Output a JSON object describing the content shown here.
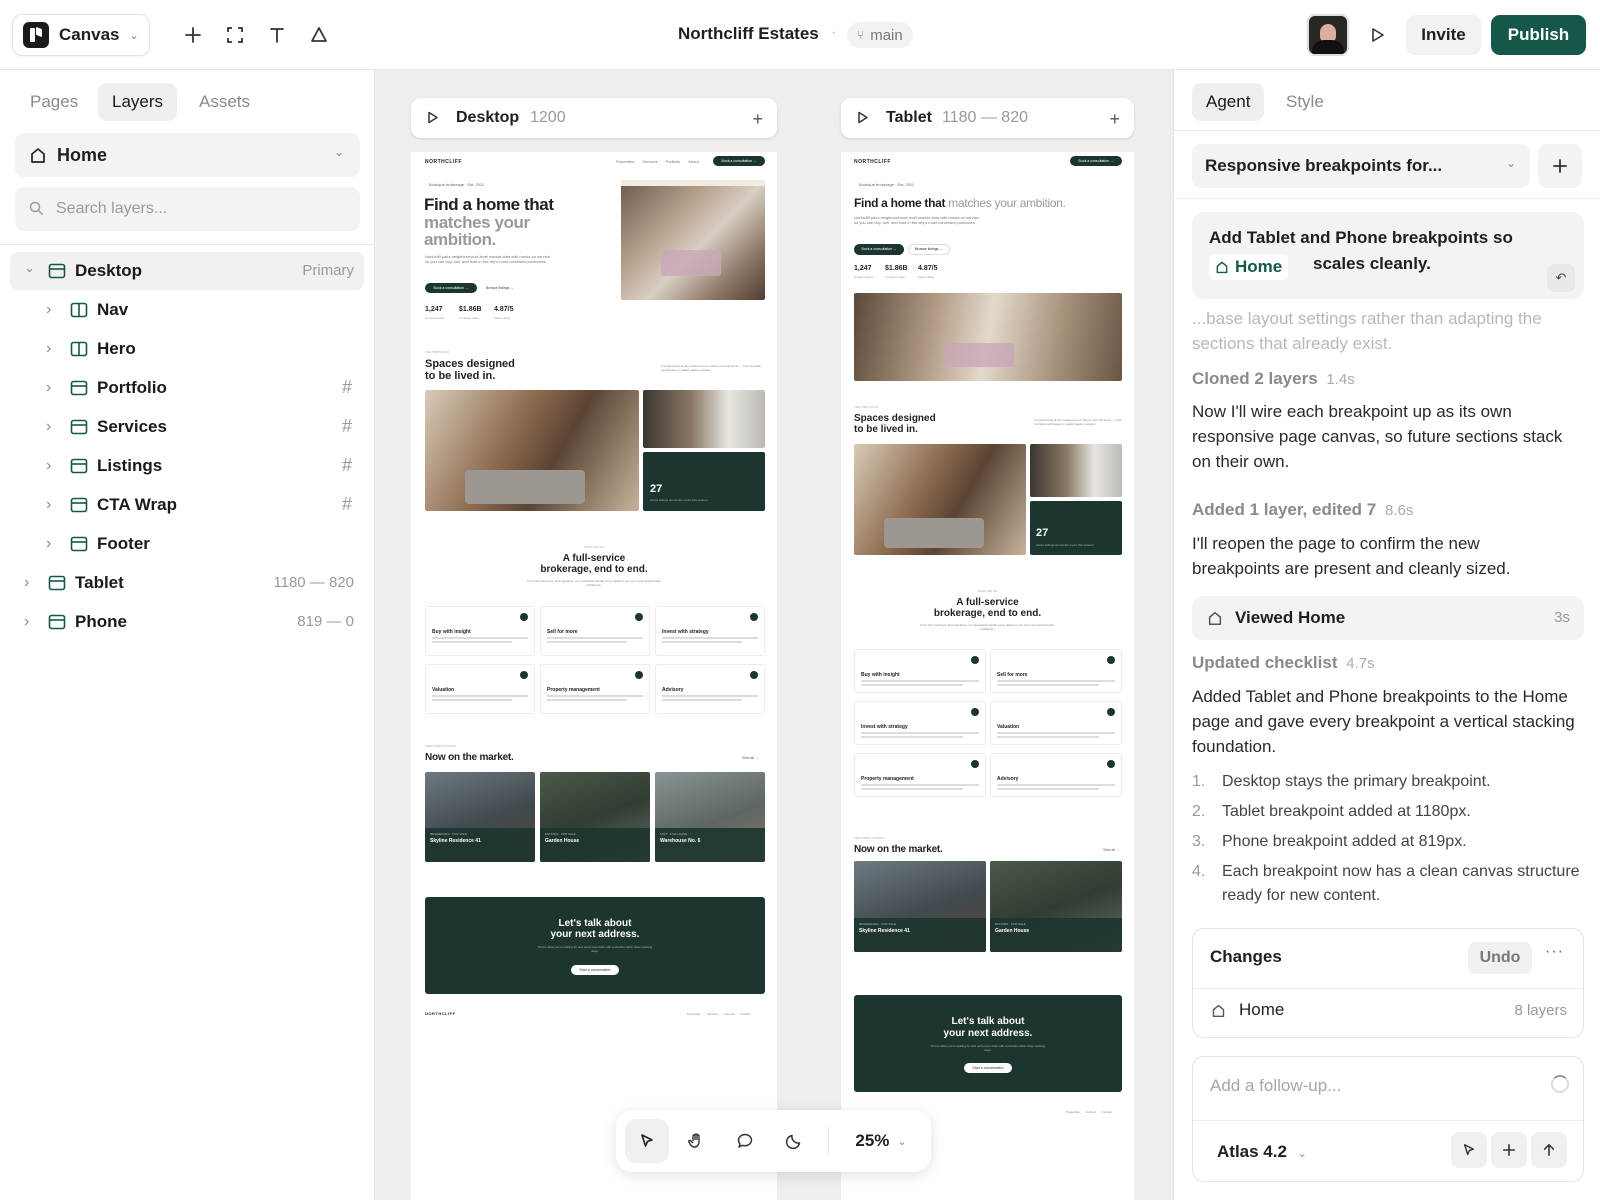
{
  "topbar": {
    "app_name": "Canvas",
    "project_title": "Northcliff Estates",
    "branch": "main",
    "invite_label": "Invite",
    "publish_label": "Publish"
  },
  "left_panel": {
    "tabs": [
      "Pages",
      "Layers",
      "Assets"
    ],
    "active_tab": "Layers",
    "page_select": "Home",
    "search_placeholder": "Search layers...",
    "layers": [
      {
        "name": "Desktop",
        "meta": "Primary",
        "icon": "frame-icon"
      },
      {
        "name": "Nav",
        "meta": "",
        "icon": "columns-icon"
      },
      {
        "name": "Hero",
        "meta": "",
        "icon": "columns-icon"
      },
      {
        "name": "Portfolio",
        "meta": "#",
        "icon": "frame-icon"
      },
      {
        "name": "Services",
        "meta": "#",
        "icon": "frame-icon"
      },
      {
        "name": "Listings",
        "meta": "#",
        "icon": "frame-icon"
      },
      {
        "name": "CTA Wrap",
        "meta": "#",
        "icon": "frame-icon"
      },
      {
        "name": "Footer",
        "meta": "",
        "icon": "frame-icon"
      },
      {
        "name": "Tablet",
        "meta": "1180 — 820",
        "icon": "frame-icon"
      },
      {
        "name": "Phone",
        "meta": "819 — 0",
        "icon": "frame-icon"
      }
    ]
  },
  "canvas": {
    "desktop_frame": {
      "name": "Desktop",
      "size": "1200"
    },
    "tablet_frame": {
      "name": "Tablet",
      "size": "1180 — 820"
    },
    "zoom": "25%",
    "site": {
      "logo": "NORTHCLIFF",
      "nav": [
        "Properties",
        "Services",
        "Portfolio",
        "About"
      ],
      "nav_cta": "Book a consultation →",
      "eyebrow": "Boutique brokerage · Est. 2011",
      "hero_title_1": "Find a home that",
      "hero_title_2": "matches your",
      "hero_title_3": "ambition.",
      "hero_title_rest": "matches your ambition.",
      "hero_body": "Northcliff pairs neighbourhood-level market data with hands-on service, so you can buy, sell, and hold in the city's most contested postcodes.",
      "hero_primary": "Book a consultation →",
      "hero_secondary": "Browse listings →",
      "stats": [
        {
          "value": "1,247",
          "label": "Homes closed"
        },
        {
          "value": "$1.86B",
          "label": "In closed value"
        },
        {
          "value": "4.87/5",
          "label": "Client rating"
        }
      ],
      "portfolio_eyebrow": "THE PORTFOLIO",
      "portfolio_title_1": "Spaces designed",
      "portfolio_title_2": "to be lived in.",
      "portfolio_note": "A curated look at the residences our clients now call home — from riverside penthouses to walled garden estates.",
      "portfolio_count": "27",
      "portfolio_count_label": "Active listings across the metro this season.",
      "services_eyebrow": "WHAT WE DO",
      "services_title_1": "A full-service",
      "services_title_2": "brokerage, end to end.",
      "services_sub": "From first viewing to final signature, our specialists handle every detail so you can move forward with confidence.",
      "services": [
        "Buy with insight",
        "Sell for more",
        "Invest with strategy",
        "Valuation",
        "Property management",
        "Advisory"
      ],
      "listings_eyebrow": "FEATURED LISTINGS",
      "listings_title": "Now on the market.",
      "listings_link": "View all →",
      "listings": [
        {
          "tag": "RESIDENCES · FOR SALE",
          "name": "Skyline Residence 41"
        },
        {
          "tag": "ESTATES · FOR SALE",
          "name": "Garden House"
        },
        {
          "tag": "LOFT · FOR LEASE",
          "name": "Warehouse No. 6"
        }
      ],
      "cta_title_1": "Let's talk about",
      "cta_title_2": "your next address.",
      "cta_body": "Tell us what you're looking for and we'll come back with a shortlist within three working days.",
      "cta_button": "Start a conversation",
      "footer_logo": "NORTHCLIFF",
      "footer_links": [
        "Properties",
        "Services",
        "Journal",
        "Contact"
      ]
    }
  },
  "right_panel": {
    "tabs": [
      "Agent",
      "Style"
    ],
    "active_tab": "Agent",
    "thread_title": "Responsive breakpoints for...",
    "prompt_line1": "Add Tablet and Phone breakpoints so",
    "prompt_chip": "Home",
    "prompt_line2": "scales cleanly.",
    "faded_text": "...base layout settings rather than adapting the sections that already exist.",
    "step1_label": "Cloned 2 layers",
    "step1_time": "1.4s",
    "step1_text": "Now I'll wire each breakpoint up as its own responsive page canvas, so future sections stack on their own.",
    "step2_label": "Added 1 layer, edited 7",
    "step2_time": "8.6s",
    "step2_text": "I'll reopen the page to confirm the new breakpoints are present and cleanly sized.",
    "viewed_label": "Viewed Home",
    "viewed_time": "3s",
    "step3_label": "Updated checklist",
    "step3_time": "4.7s",
    "step3_text": "Added Tablet and Phone breakpoints to the Home page and gave every breakpoint a vertical stacking foundation.",
    "checklist": [
      "Desktop stays the primary breakpoint.",
      "Tablet breakpoint added at 1180px.",
      "Phone breakpoint added at 819px.",
      "Each breakpoint now has a clean canvas structure ready for new content."
    ],
    "changes_title": "Changes",
    "undo_label": "Undo",
    "changes_item": "Home",
    "changes_count": "8 layers",
    "followup_placeholder": "Add a follow-up...",
    "model": "Atlas 4.2"
  },
  "colors": {
    "brand": "#15584a",
    "site_dark": "#1d3530",
    "canvas_bg": "#efeeec"
  }
}
